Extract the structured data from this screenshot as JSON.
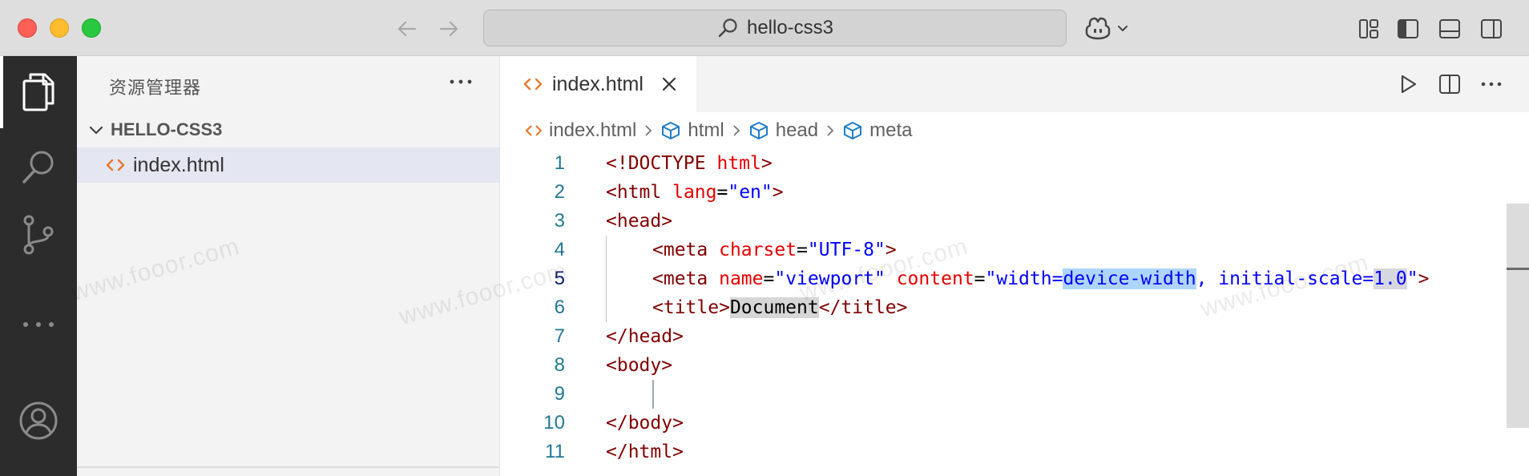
{
  "window": {
    "search_text": "hello-css3"
  },
  "sidebar": {
    "title": "资源管理器",
    "folder_name": "HELLO-CSS3",
    "files": [
      {
        "name": "index.html"
      }
    ]
  },
  "editor": {
    "active_tab": "index.html",
    "breadcrumb": [
      "index.html",
      "html",
      "head",
      "meta"
    ],
    "current_line": 5,
    "lines": [
      {
        "num": "1"
      },
      {
        "num": "2"
      },
      {
        "num": "3"
      },
      {
        "num": "4"
      },
      {
        "num": "5"
      },
      {
        "num": "6"
      },
      {
        "num": "7"
      },
      {
        "num": "8"
      },
      {
        "num": "9"
      },
      {
        "num": "10"
      },
      {
        "num": "11"
      }
    ],
    "code": {
      "l1_tag": "<!DOCTYPE",
      "l1_attr": "html",
      "l1_end": ">",
      "l2_tag": "<html",
      "l2_attr": "lang",
      "l2_eq": "=",
      "l2_val": "\"en\"",
      "l2_end": ">",
      "l3_tag": "<head>",
      "l4_tag": "<meta",
      "l4_attr": "charset",
      "l4_eq": "=",
      "l4_val": "\"UTF-8\"",
      "l4_end": ">",
      "l5_tag": "<meta",
      "l5_attr1": "name",
      "l5_eq1": "=",
      "l5_val1": "\"viewport\"",
      "l5_attr2": "content",
      "l5_eq2": "=",
      "l5_val2a": "\"width=",
      "l5_val2b": "device-width",
      "l5_val2c": ", initial-scale=",
      "l5_val2d": "1.0",
      "l5_val2e": "\"",
      "l5_end": ">",
      "l6_open": "<title>",
      "l6_text": "Document",
      "l6_close": "</title>",
      "l7_tag": "</head>",
      "l8_tag": "<body>",
      "l10_tag": "</body>",
      "l11_tag": "</html>"
    }
  },
  "watermark": "www.fooor.com",
  "colors": {
    "activity_bar": "#2c2c2c",
    "sidebar_bg": "#f3f3f3",
    "selection": "#add6ff",
    "tag": "#800000",
    "attribute": "#e50000",
    "value": "#0000ff",
    "line_number": "#237893"
  },
  "icons": {
    "activity": [
      "files-icon",
      "search-icon",
      "source-control-icon",
      "more-icon",
      "account-icon"
    ],
    "layout": [
      "customize-layout-icon",
      "toggle-sidebar-icon",
      "toggle-panel-icon",
      "toggle-secondary-sidebar-icon"
    ]
  }
}
